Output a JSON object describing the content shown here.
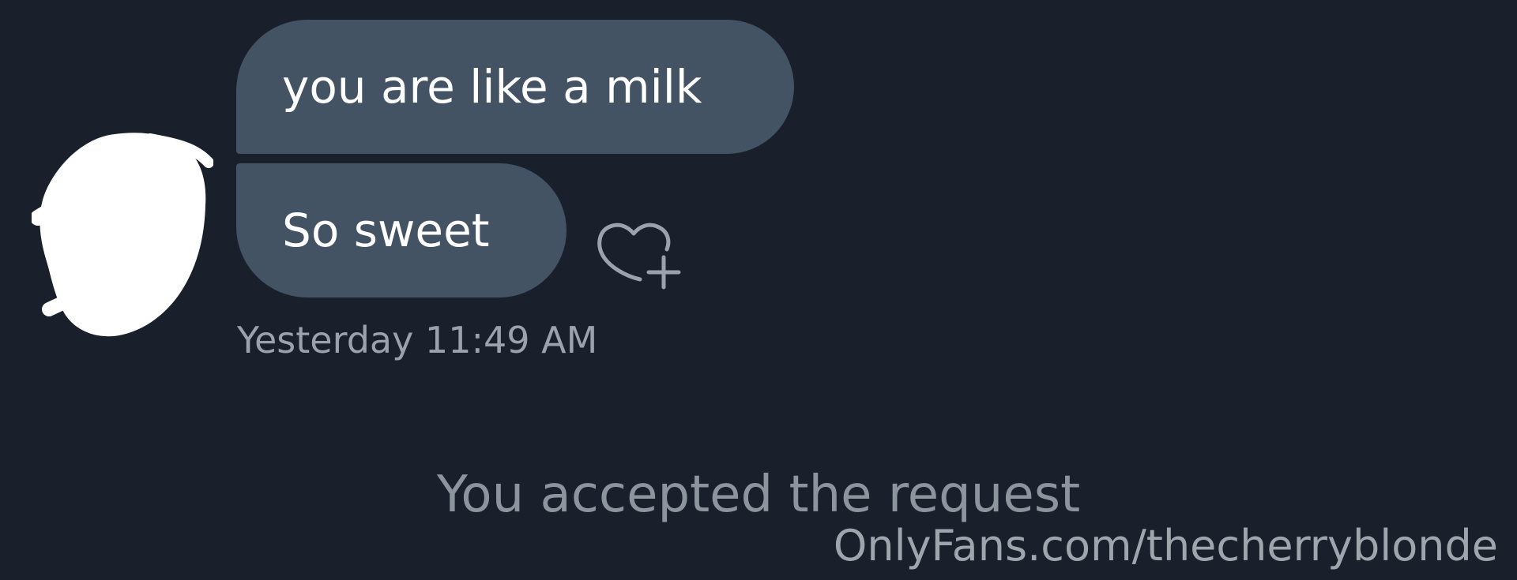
{
  "messages": [
    {
      "text": "you are like a milk"
    },
    {
      "text": "So sweet"
    }
  ],
  "timestamp": "Yesterday 11:49 AM",
  "system_message": "You accepted the request",
  "watermark": "OnlyFans.com/thecherryblonde",
  "icons": {
    "avatar": "redacted-avatar",
    "like": "heart-plus-icon"
  },
  "colors": {
    "background": "#19202b",
    "bubble": "#435364",
    "message_text": "#ffffff",
    "meta_text": "#9aa3ad"
  }
}
